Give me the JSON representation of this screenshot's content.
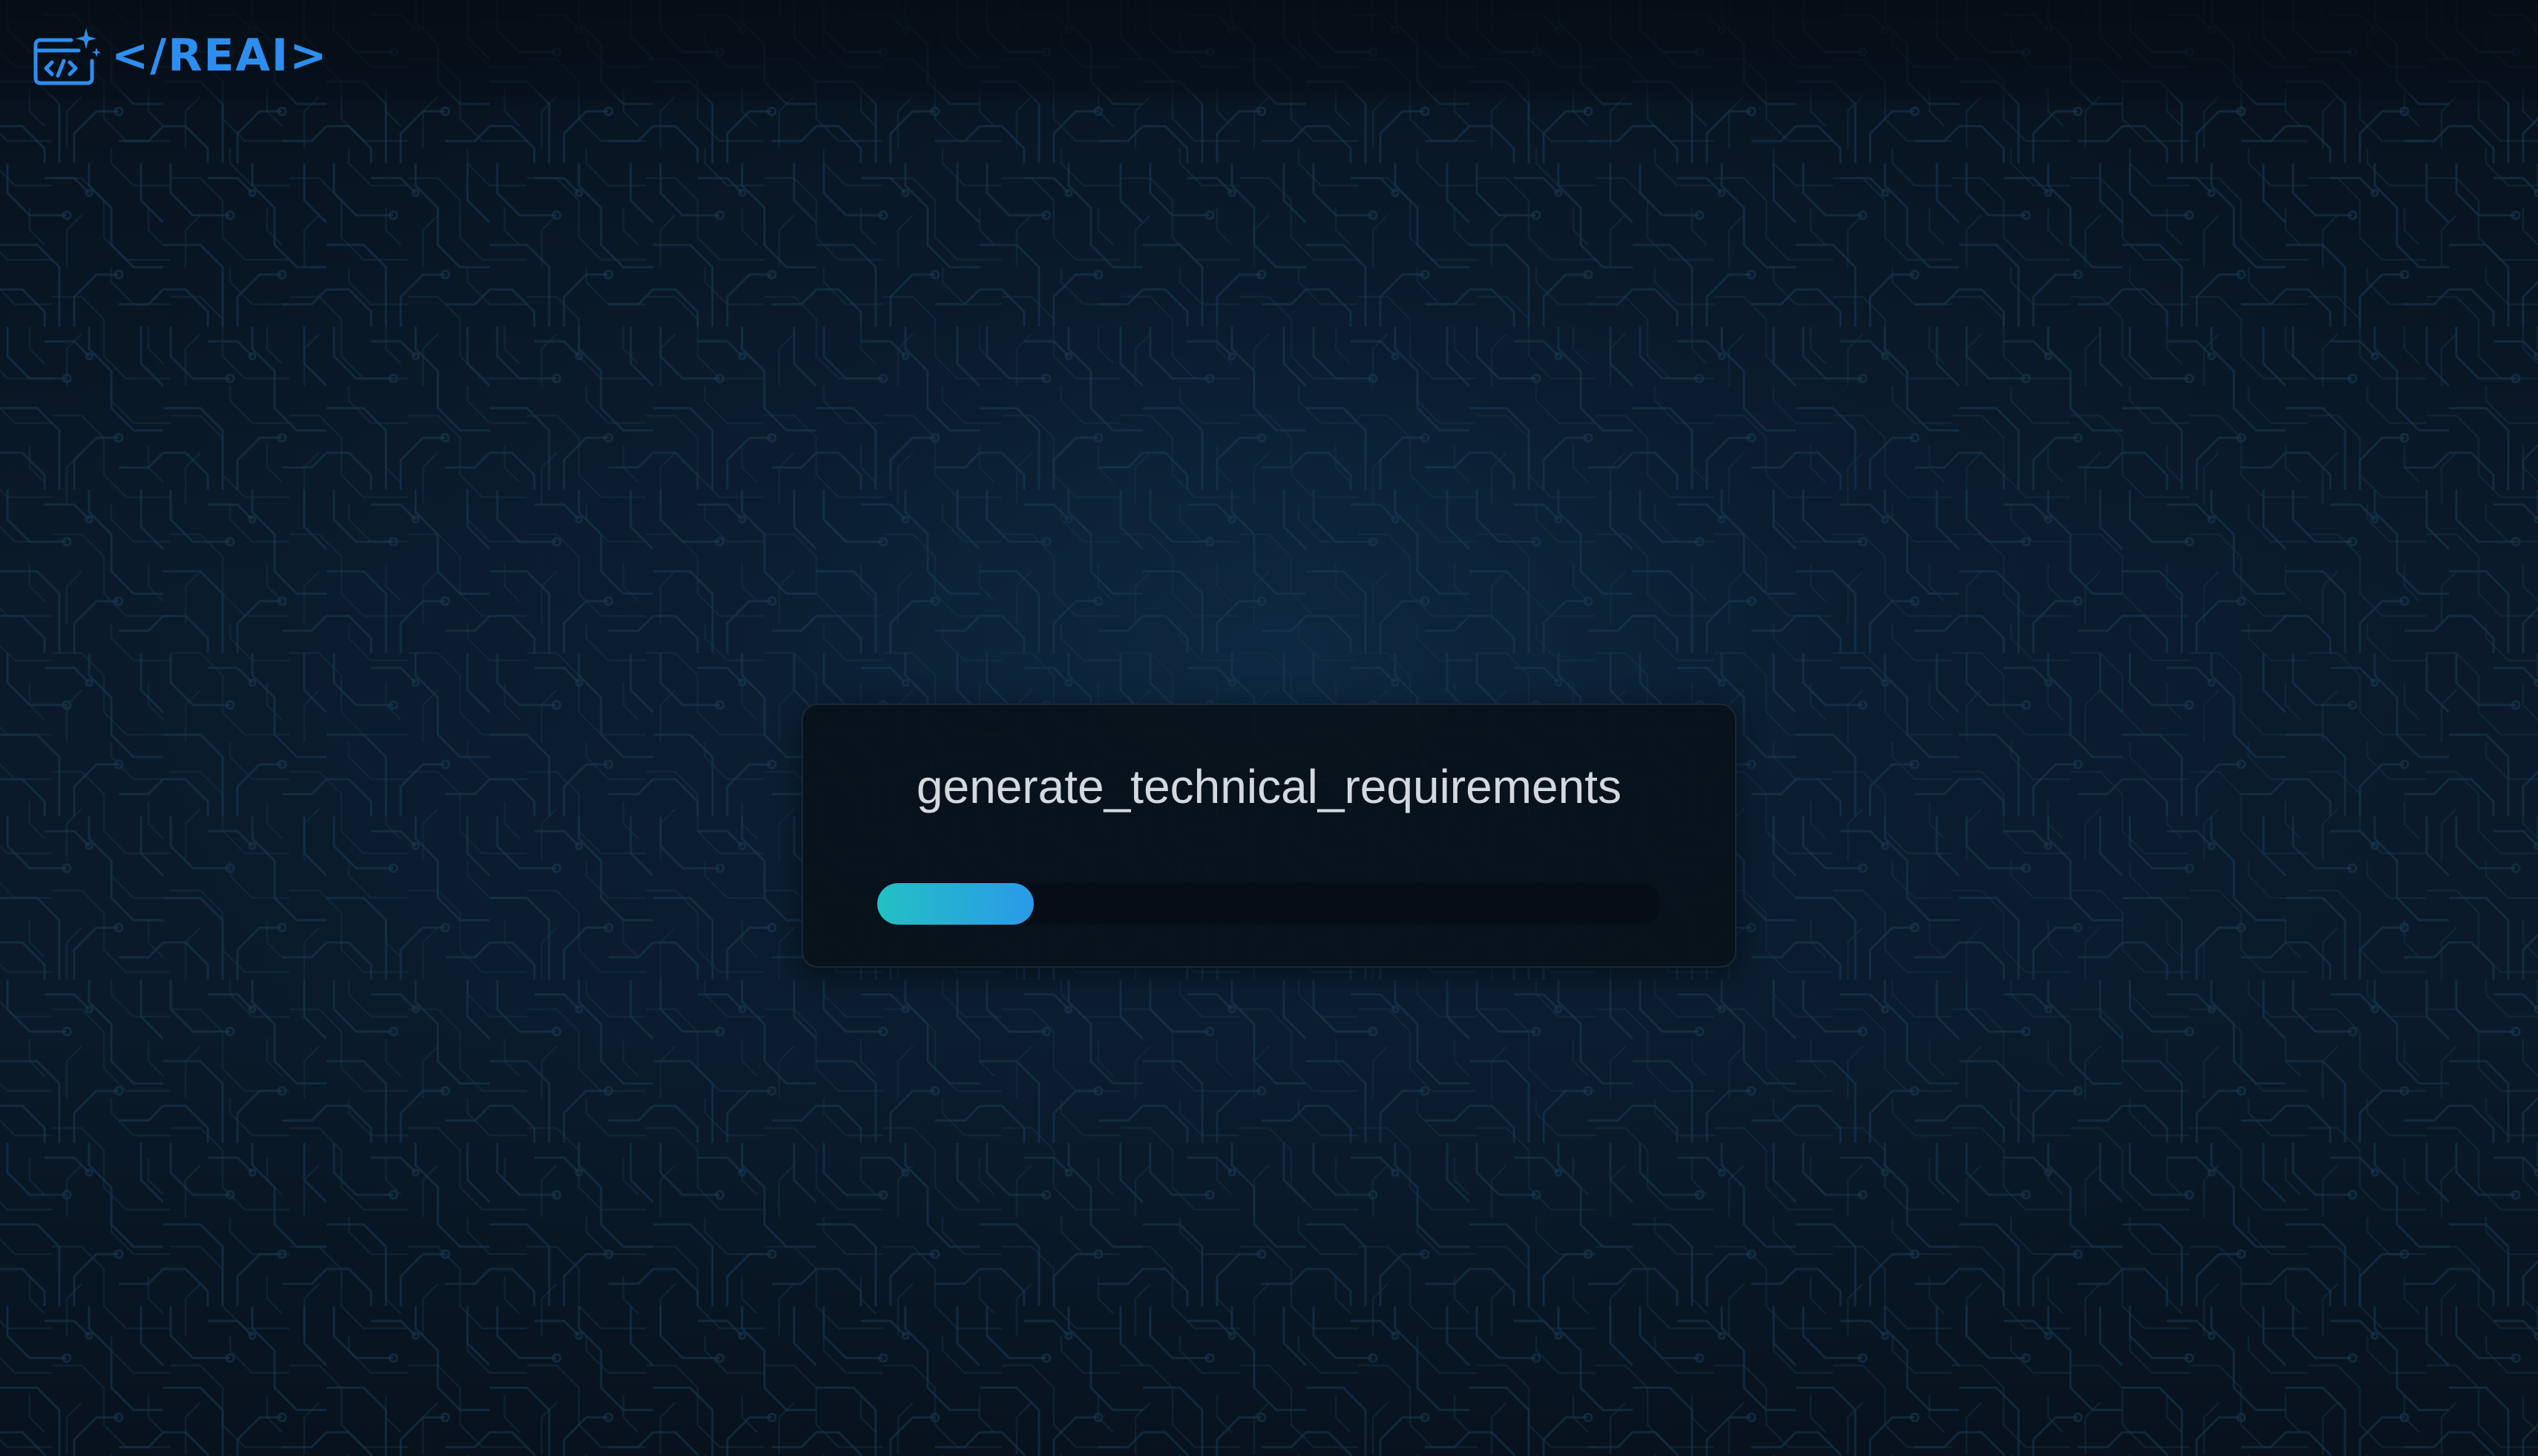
{
  "header": {
    "logo_text": "</REAI>",
    "logo_icon": "code-window-sparkle-icon",
    "brand_color": "#2e8ef0"
  },
  "loading_card": {
    "task_name": "generate_technical_requirements",
    "progress_fraction": 0.2,
    "progress_colors": [
      "#22c0c4",
      "#2a9ae8"
    ]
  },
  "background": {
    "pattern": "circuit-traces",
    "base_color": "#0a1a2a"
  }
}
